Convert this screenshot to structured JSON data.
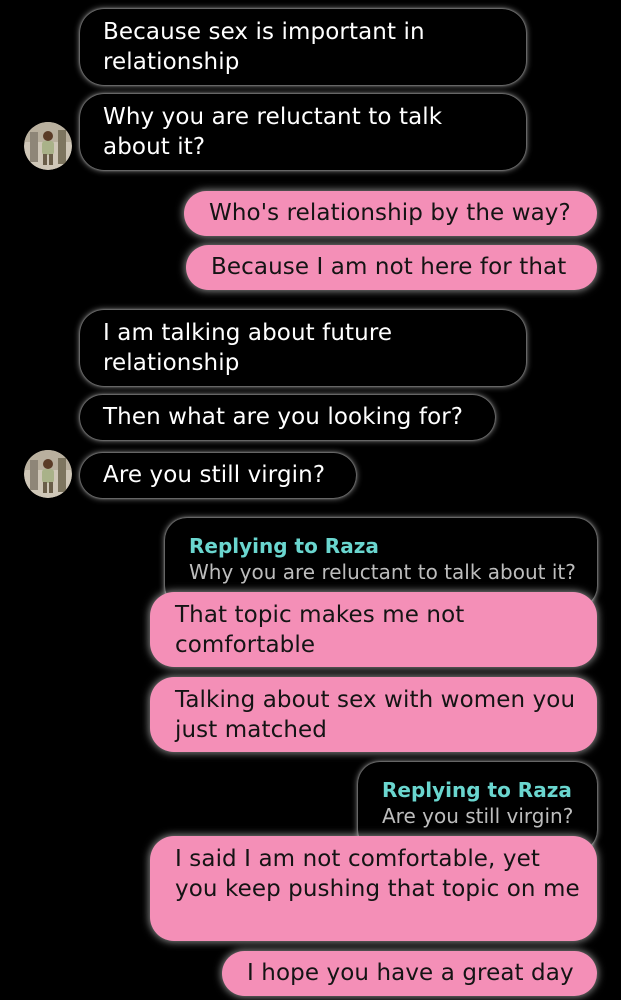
{
  "conversation": {
    "messages": [
      {
        "from": "them",
        "text": "Because sex is important in relationship"
      },
      {
        "from": "them",
        "text": "Why you are reluctant to talk about it?"
      },
      {
        "from": "me",
        "text": "Who's relationship by the way?"
      },
      {
        "from": "me",
        "text": "Because I am not here for that"
      },
      {
        "from": "them",
        "text": "I am talking about future relationship"
      },
      {
        "from": "them",
        "text": "Then what are you looking for?"
      },
      {
        "from": "them",
        "text": "Are you still virgin?"
      },
      {
        "from": "me",
        "reply_to": {
          "label": "Replying to Raza",
          "quote": "Why you are reluctant to talk about it?"
        },
        "text": "That topic makes me not comfortable"
      },
      {
        "from": "me",
        "text": "Talking about sex with women you just matched"
      },
      {
        "from": "me",
        "reply_to": {
          "label": "Replying to Raza",
          "quote": "Are you still virgin?"
        },
        "text": "I said I am not comfortable, yet you keep pushing that topic on me"
      },
      {
        "from": "me",
        "text": "I hope you have a great day"
      }
    ]
  },
  "colors": {
    "background": "#000000",
    "outgoing_bubble": "#f48fb7",
    "reply_label": "#6ad6cf"
  },
  "icons": {
    "contact_avatar": "avatar-photo-icon"
  }
}
